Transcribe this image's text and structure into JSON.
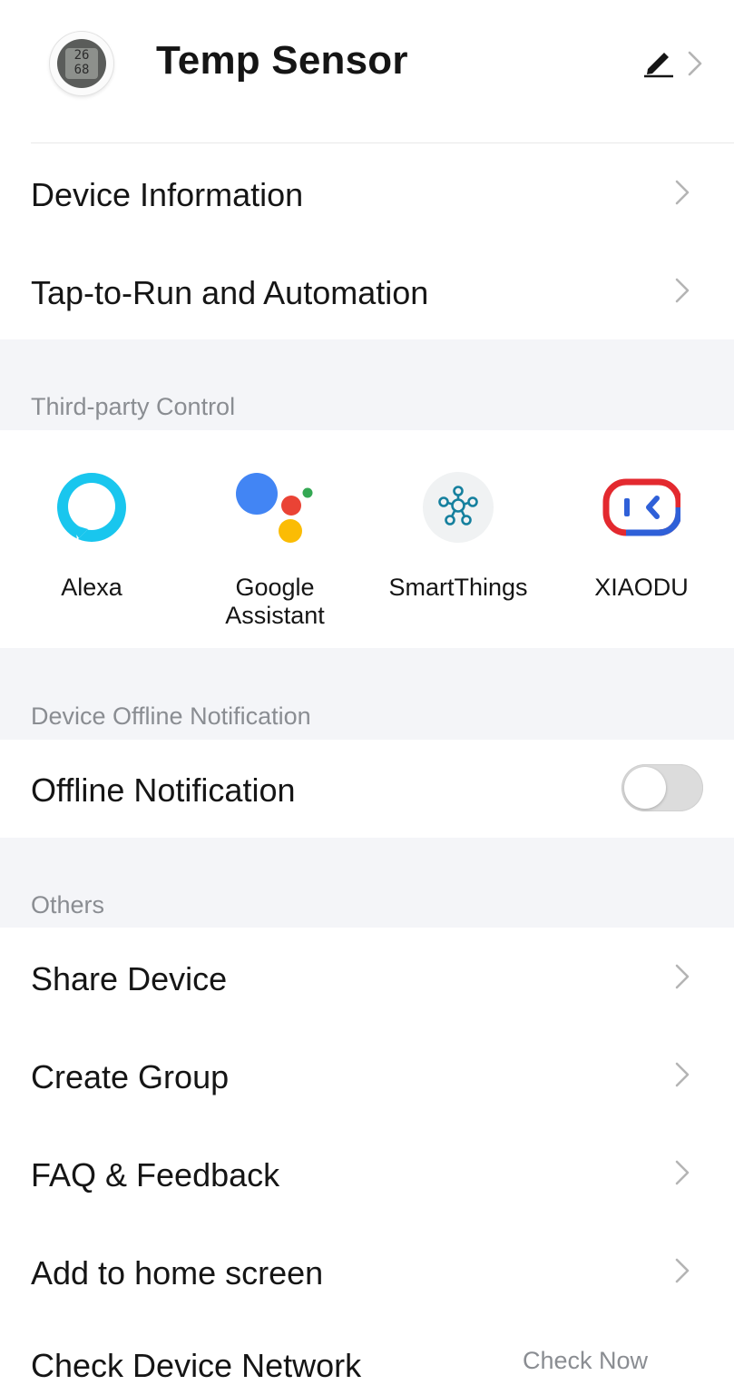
{
  "header": {
    "device_name": "Temp Sensor",
    "device_image": "sensor-thumbnail",
    "display_readings": [
      "26",
      "68"
    ]
  },
  "menu_top": [
    {
      "label": "Device Information"
    },
    {
      "label": "Tap-to-Run and Automation"
    }
  ],
  "third_party": {
    "title": "Third-party Control",
    "items": [
      {
        "label": "Alexa",
        "icon": "alexa-icon"
      },
      {
        "label": "Google Assistant",
        "line1": "Google",
        "line2": "Assistant",
        "icon": "google-assistant-icon"
      },
      {
        "label": "SmartThings",
        "icon": "smartthings-icon"
      },
      {
        "label": "XIAODU",
        "icon": "xiaodu-icon"
      }
    ]
  },
  "offline": {
    "title": "Device Offline Notification",
    "label": "Offline Notification",
    "enabled": false
  },
  "others": {
    "title": "Others",
    "items": [
      {
        "label": "Share Device"
      },
      {
        "label": "Create Group"
      },
      {
        "label": "FAQ & Feedback"
      },
      {
        "label": "Add to home screen"
      },
      {
        "label": "Check Device Network",
        "value": "Check Now"
      }
    ]
  },
  "colors": {
    "section_bg": "#f4f5f8",
    "section_text": "#8a8d92",
    "alexa": "#19c6ee",
    "google_blue": "#4285f4",
    "google_red": "#ea4335",
    "google_yellow": "#fbbc04",
    "google_green": "#34a853",
    "smartthings": "#15809e",
    "xiaodu_red": "#e3292f",
    "xiaodu_blue": "#2f60d8",
    "toggle_off": "#dcdcdc"
  }
}
